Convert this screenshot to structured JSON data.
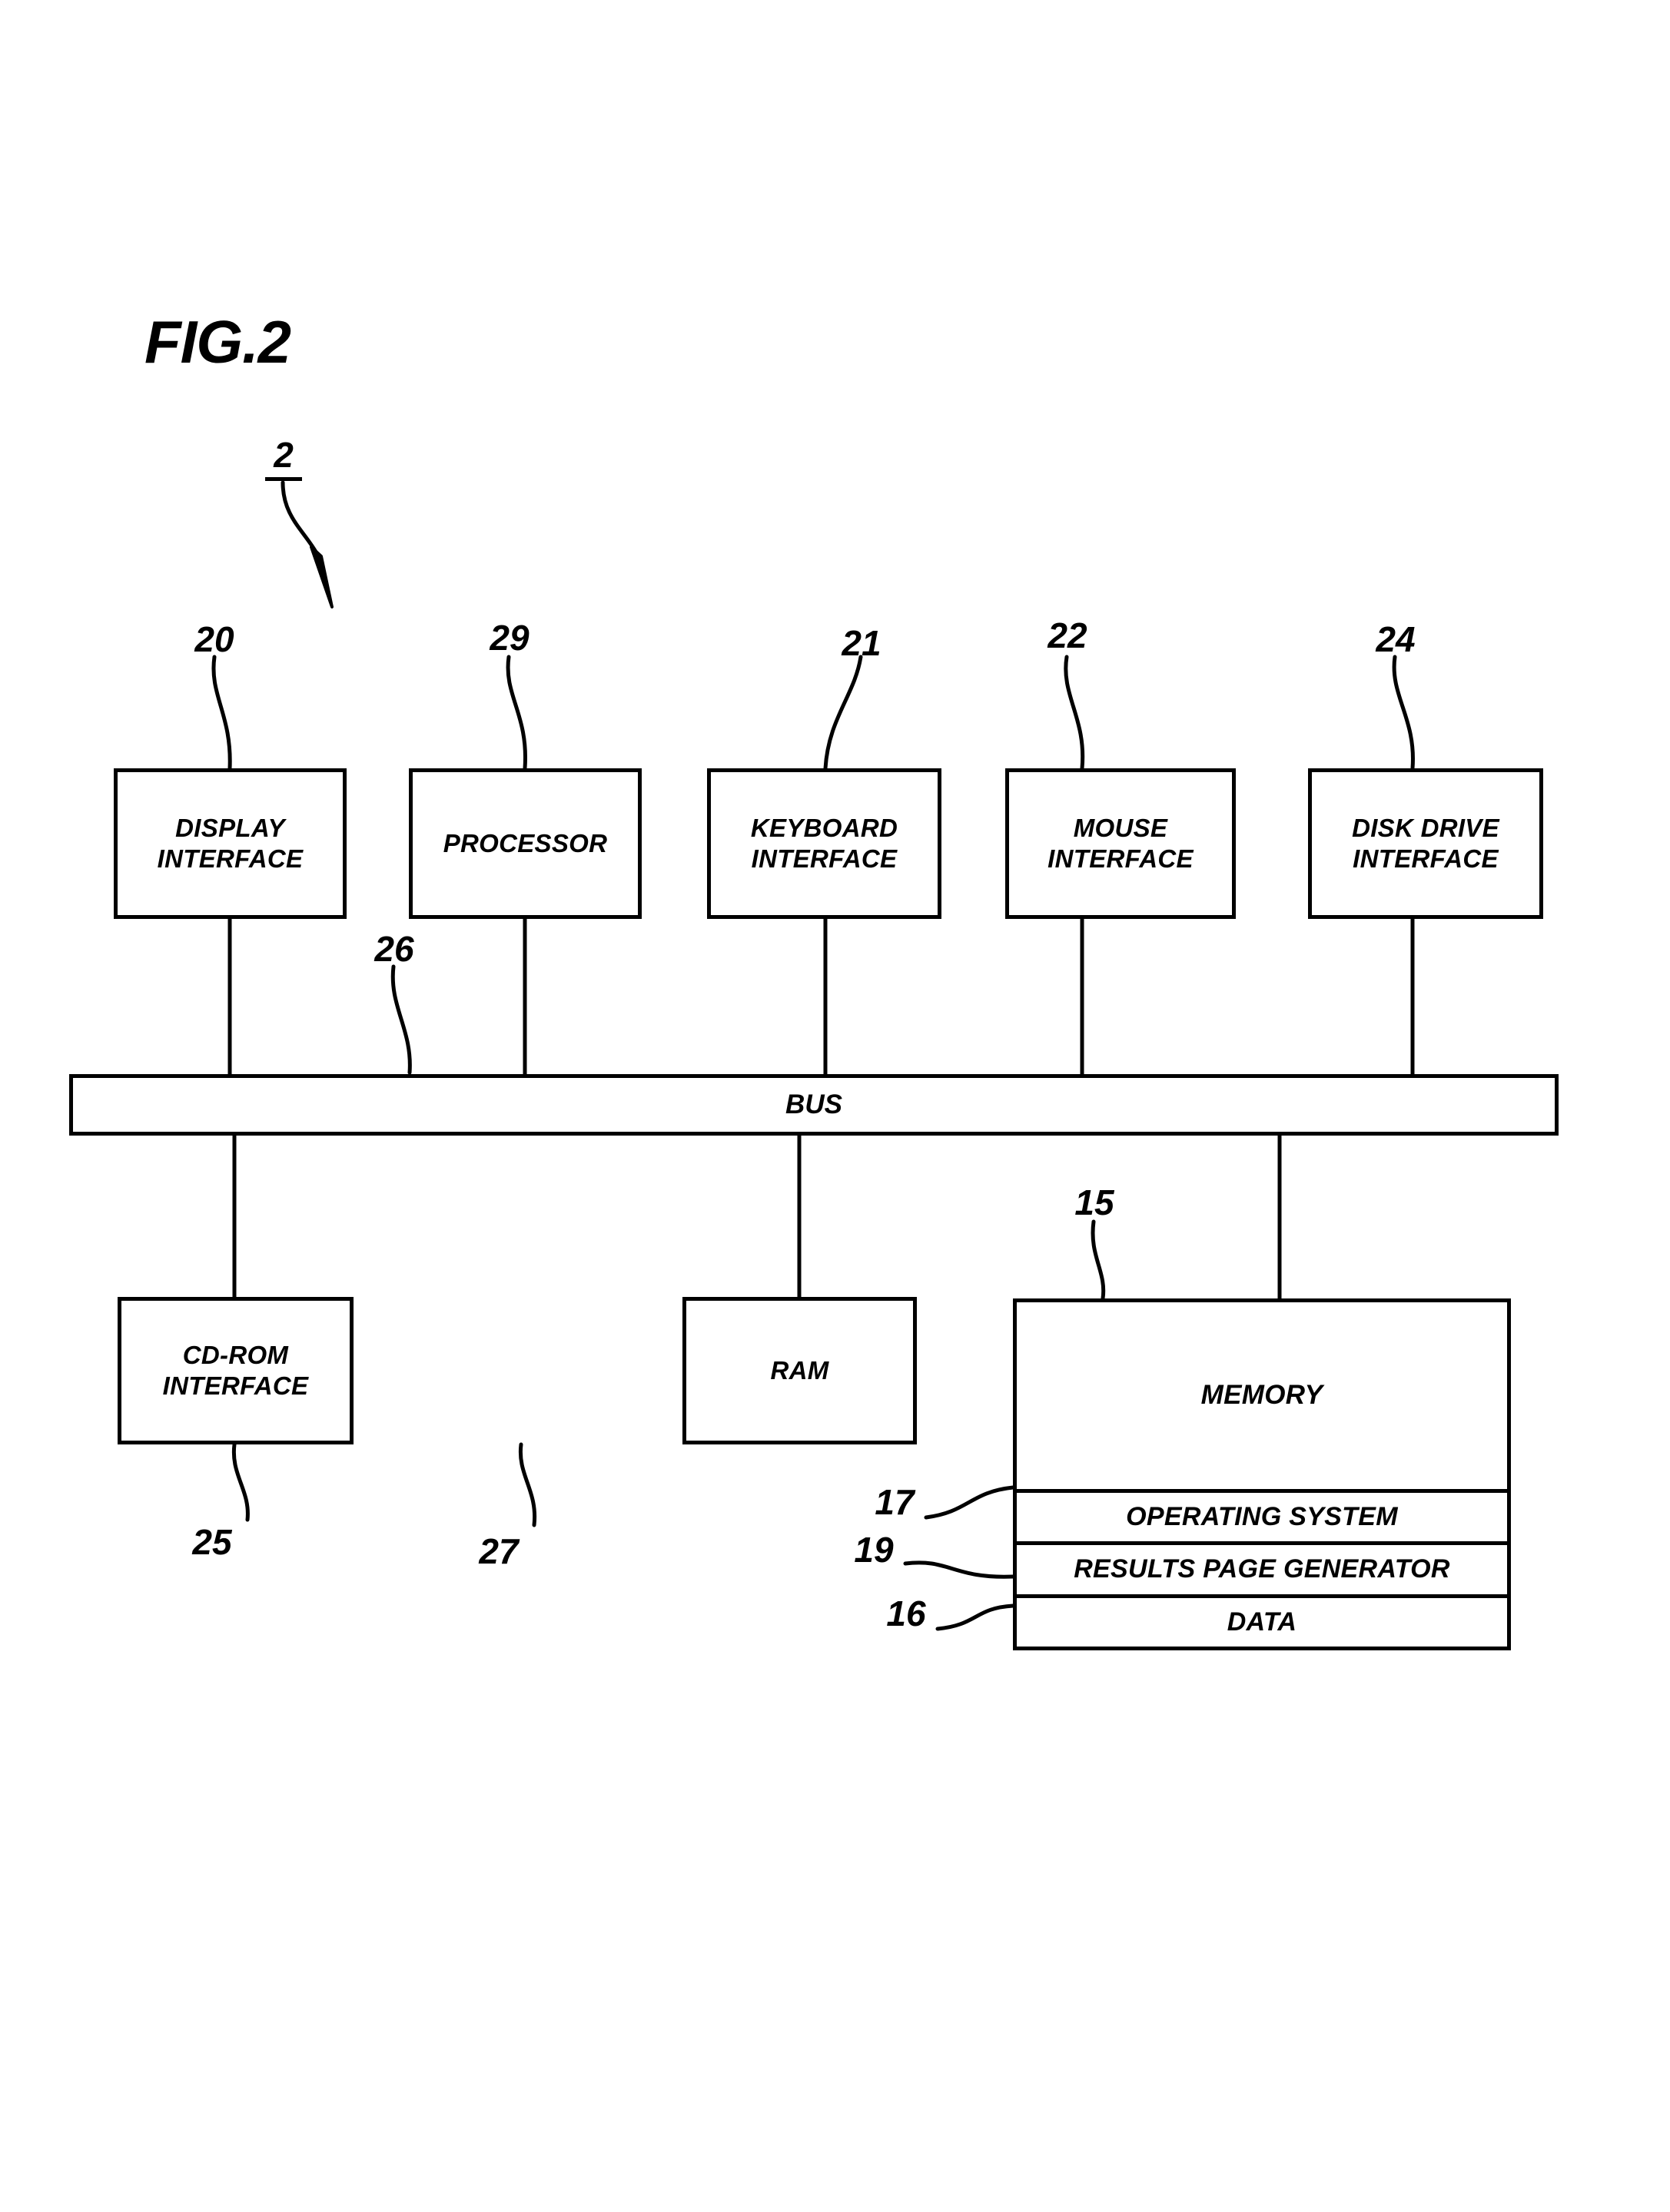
{
  "figure": {
    "title": "FIG.2",
    "system_ref": "2"
  },
  "blocks": [
    {
      "id": "display-interface",
      "label": "DISPLAY\nINTERFACE",
      "ref": "20"
    },
    {
      "id": "processor",
      "label": "PROCESSOR",
      "ref": "29"
    },
    {
      "id": "keyboard-interface",
      "label": "KEYBOARD\nINTERFACE",
      "ref": "21"
    },
    {
      "id": "mouse-interface",
      "label": "MOUSE\nINTERFACE",
      "ref": "22"
    },
    {
      "id": "disk-drive-interface",
      "label": "DISK DRIVE\nINTERFACE",
      "ref": "24"
    },
    {
      "id": "cdrom-interface",
      "label": "CD-ROM\nINTERFACE",
      "ref": "25"
    },
    {
      "id": "ram",
      "label": "RAM",
      "ref": "27"
    },
    {
      "id": "memory",
      "label": "MEMORY",
      "ref": "15"
    }
  ],
  "bus": {
    "label": "BUS",
    "ref": "26"
  },
  "memory_sections": [
    {
      "id": "operating-system",
      "label": "OPERATING SYSTEM",
      "ref": "17"
    },
    {
      "id": "results-page-generator",
      "label": "RESULTS PAGE GENERATOR",
      "ref": "19"
    },
    {
      "id": "data",
      "label": "DATA",
      "ref": "16"
    }
  ],
  "colors": {
    "ink": "#000000",
    "paper": "#ffffff"
  }
}
